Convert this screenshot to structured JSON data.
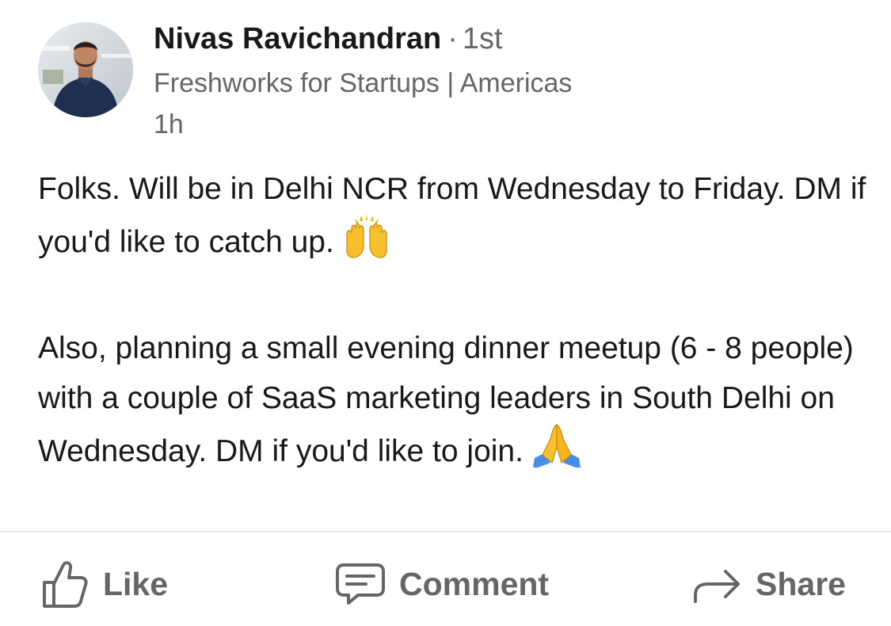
{
  "post": {
    "author": {
      "name": "Nivas Ravichandran",
      "separator": "·",
      "connection_degree": "1st",
      "headline": "Freshworks for Startups | Americas",
      "time_ago": "1h",
      "avatar_icon": "profile-photo"
    },
    "body": {
      "paragraph1": "Folks. Will be in Delhi NCR from Wednesday to Friday. DM if you'd like to catch up.",
      "paragraph1_emoji": "raising-hands-emoji",
      "paragraph2": "Also, planning a small evening dinner meetup (6 - 8 people) with a couple of SaaS marketing leaders in South Delhi on Wednesday. DM if you'd like to join.",
      "paragraph2_emoji": "folded-hands-emoji"
    }
  },
  "actions": {
    "like_label": "Like",
    "like_icon": "thumbs-up-icon",
    "comment_label": "Comment",
    "comment_icon": "comment-bubble-icon",
    "share_label": "Share",
    "share_icon": "share-arrow-icon"
  },
  "colors": {
    "primary_text": "#191919",
    "secondary_text": "#666666",
    "divider": "#e8e8e8",
    "background": "#ffffff"
  }
}
